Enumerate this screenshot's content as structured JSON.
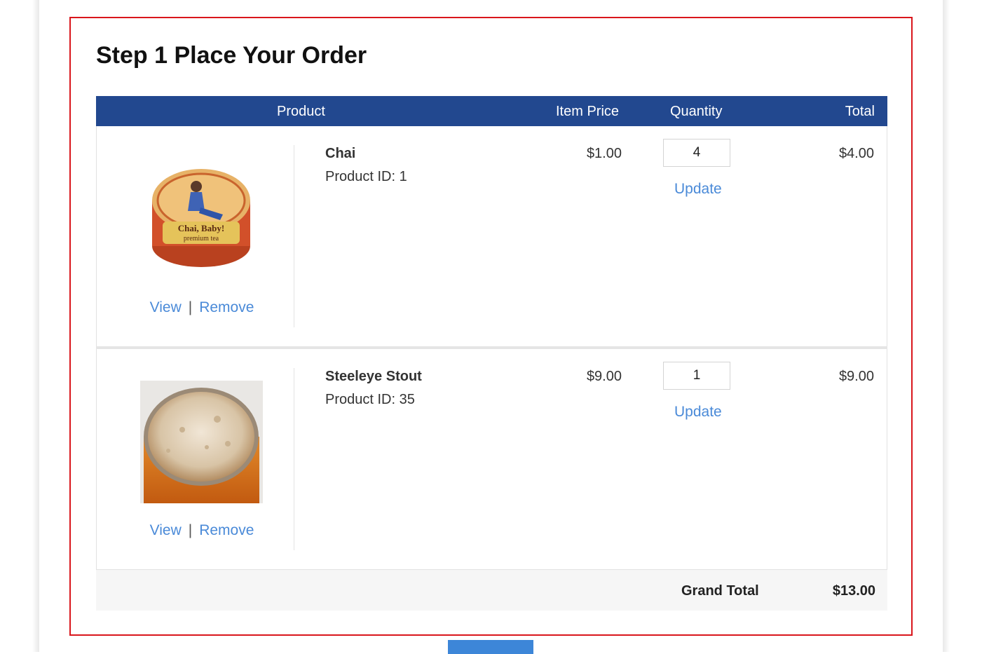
{
  "order": {
    "title": "Step 1 Place Your Order",
    "columns": {
      "product": "Product",
      "item_price": "Item Price",
      "quantity": "Quantity",
      "total": "Total"
    },
    "items": [
      {
        "name": "Chai",
        "product_id": "Product ID: 1",
        "price": "$1.00",
        "quantity": "4",
        "total": "$4.00",
        "view_label": "View",
        "separator": "|",
        "remove_label": "Remove",
        "update_label": "Update",
        "image_label": "Chai, Baby!",
        "image_sub": "premium tea"
      },
      {
        "name": "Steeleye Stout",
        "product_id": "Product ID: 35",
        "price": "$9.00",
        "quantity": "1",
        "total": "$9.00",
        "view_label": "View",
        "separator": "|",
        "remove_label": "Remove",
        "update_label": "Update"
      }
    ],
    "grand_total_label": "Grand Total",
    "grand_total_value": "$13.00"
  },
  "colors": {
    "header_bg": "#22488f",
    "link": "#4a8ad8",
    "box_border": "#d9161c",
    "button": "#3d86d8"
  }
}
